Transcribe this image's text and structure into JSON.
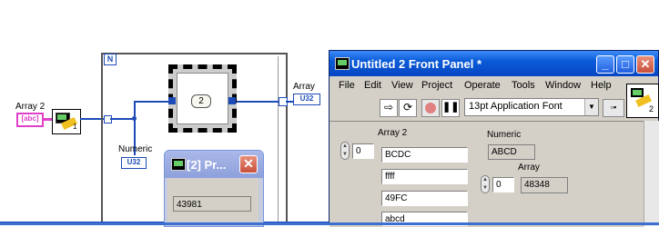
{
  "diagram": {
    "array2_label": "Array 2",
    "array2_terminal": "[abc]",
    "numeric_label": "Numeric",
    "numeric_terminal": "U32",
    "array_label": "Array",
    "array_terminal": "U32",
    "loop_count_label": "N",
    "case_value": "2",
    "subvi_index": "1",
    "colors": {
      "wire_numeric": "#1c4bb8",
      "wire_string": "#e040c8",
      "loop_border": "#555555"
    }
  },
  "probe_window": {
    "title": "[2] Pr...",
    "value": "43981",
    "close_icon": "close-icon"
  },
  "front_panel": {
    "title": "Untitled 2 Front Panel *",
    "menus": [
      "File",
      "Edit",
      "View",
      "Project",
      "Operate",
      "Tools",
      "Window",
      "Help"
    ],
    "font_select": "13pt Application Font",
    "connector_index": "2",
    "array2": {
      "label": "Array 2",
      "index": "0",
      "items": [
        "BCDC",
        "ffff",
        "49FC",
        "abcd"
      ]
    },
    "numeric": {
      "label": "Numeric",
      "value": "ABCD"
    },
    "array": {
      "label": "Array",
      "index": "0",
      "value": "48348"
    }
  }
}
